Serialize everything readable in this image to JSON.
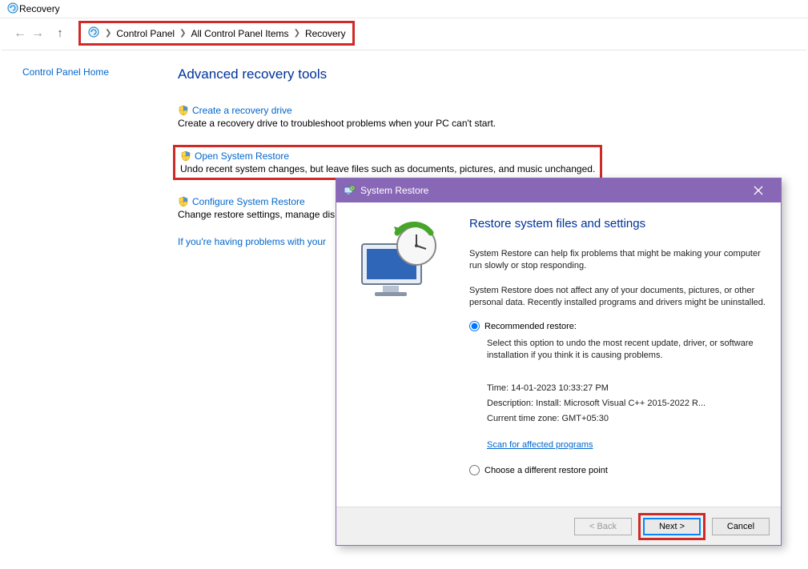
{
  "window": {
    "title": "Recovery"
  },
  "breadcrumb": {
    "items": [
      "Control Panel",
      "All Control Panel Items",
      "Recovery"
    ]
  },
  "sidebar": {
    "home": "Control Panel Home"
  },
  "page": {
    "heading": "Advanced recovery tools",
    "tools": [
      {
        "link": "Create a recovery drive",
        "desc": "Create a recovery drive to troubleshoot problems when your PC can't start."
      },
      {
        "link": "Open System Restore",
        "desc": "Undo recent system changes, but leave files such as documents, pictures, and music unchanged."
      },
      {
        "link": "Configure System Restore",
        "desc": "Change restore settings, manage dis"
      }
    ],
    "help_link": "If you're having problems with your"
  },
  "dialog": {
    "title": "System Restore",
    "heading": "Restore system files and settings",
    "para1": "System Restore can help fix problems that might be making your computer run slowly or stop responding.",
    "para2": "System Restore does not affect any of your documents, pictures, or other personal data. Recently installed programs and drivers might be uninstalled.",
    "radio_recommended": "Recommended restore:",
    "recommended_desc": "Select this option to undo the most recent update, driver, or software installation if you think it is causing problems.",
    "details": {
      "time_label": "Time:",
      "time_value": "14-01-2023 10:33:27 PM",
      "desc_label": "Description:",
      "desc_value": "Install: Microsoft Visual C++ 2015-2022 R...",
      "tz_label": "Current time zone:",
      "tz_value": "GMT+05:30"
    },
    "scan_link": "Scan for affected programs",
    "radio_different": "Choose a different restore point",
    "buttons": {
      "back": "< Back",
      "next": "Next >",
      "cancel": "Cancel"
    }
  }
}
